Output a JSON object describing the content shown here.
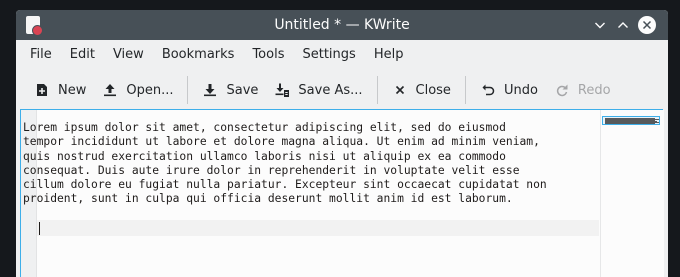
{
  "window": {
    "title": "Untitled * — KWrite",
    "controls": {
      "minimize_icon": "chevron-down-icon",
      "maximize_icon": "chevron-up-icon",
      "close_icon": "close-icon"
    }
  },
  "menu": {
    "items": [
      "File",
      "Edit",
      "View",
      "Bookmarks",
      "Tools",
      "Settings",
      "Help"
    ]
  },
  "toolbar": {
    "new_label": "New",
    "open_label": "Open...",
    "save_label": "Save",
    "save_as_label": "Save As...",
    "close_label": "Close",
    "undo_label": "Undo",
    "redo_label": "Redo"
  },
  "editor": {
    "lines": [
      "Lorem ipsum dolor sit amet, consectetur adipiscing elit, sed do eiusmod",
      "tempor incididunt ut labore et dolore magna aliqua. Ut enim ad minim veniam,",
      "quis nostrud exercitation ullamco laboris nisi ut aliquip ex ea commodo",
      "consequat. Duis aute irure dolor in reprehenderit in voluptate velit esse",
      "cillum dolore eu fugiat nulla pariatur. Excepteur sint occaecat cupidatat non",
      "proident, sunt in culpa qui officia deserunt mollit anim id est laborum."
    ]
  },
  "colors": {
    "titlebar": "#475057",
    "accent": "#3daee9",
    "window_bg": "#eff0f1"
  }
}
